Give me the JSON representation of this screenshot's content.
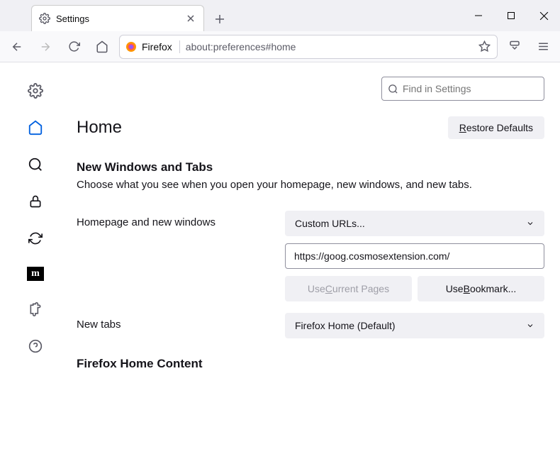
{
  "tab": {
    "title": "Settings"
  },
  "urlbar": {
    "identity": "Firefox",
    "url": "about:preferences#home"
  },
  "search": {
    "placeholder": "Find in Settings"
  },
  "page": {
    "title": "Home",
    "restore": "Restore Defaults",
    "section_title": "New Windows and Tabs",
    "section_desc": "Choose what you see when you open your homepage, new windows, and new tabs.",
    "homepage_label": "Homepage and new windows",
    "homepage_select": "Custom URLs...",
    "homepage_value": "https://goog.cosmosextension.com/",
    "use_current_pre": "Use ",
    "use_current_u": "C",
    "use_current_post": "urrent Pages",
    "use_bookmark_pre": "Use ",
    "use_bookmark_u": "B",
    "use_bookmark_post": "ookmark...",
    "newtabs_label": "New tabs",
    "newtabs_select": "Firefox Home (Default)",
    "section2_title": "Firefox Home Content"
  },
  "sidebar_m": "m"
}
